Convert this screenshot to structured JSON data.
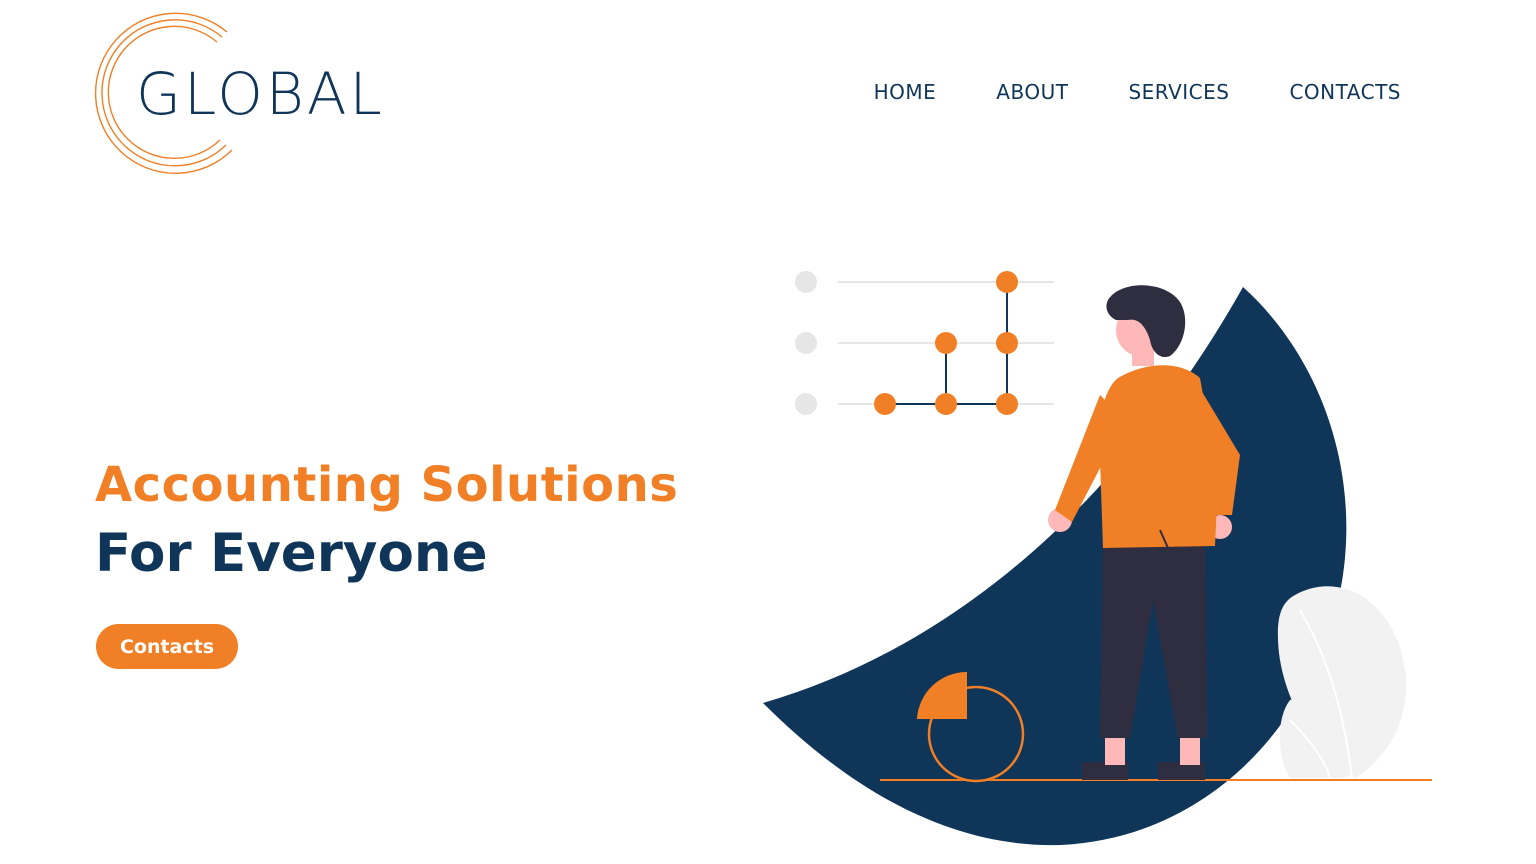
{
  "logo": {
    "text": "GLOBAL"
  },
  "nav": {
    "items": [
      {
        "label": "HOME"
      },
      {
        "label": "ABOUT"
      },
      {
        "label": "SERVICES"
      },
      {
        "label": "CONTACTS"
      }
    ]
  },
  "hero": {
    "line1": "Accounting Solutions",
    "line2": "For Everyone",
    "cta_label": "Contacts"
  },
  "colors": {
    "accent": "#f07f25",
    "navy": "#0f3559",
    "dark": "#2f2e41",
    "skin": "#ffb8b8",
    "plant": "#f2f2f2",
    "light_gray": "#e6e6e6"
  },
  "icons": [
    "logo-c-mark-icon",
    "person-illustration",
    "pie-chart-icon",
    "network-chart-icon",
    "plant-icon"
  ]
}
